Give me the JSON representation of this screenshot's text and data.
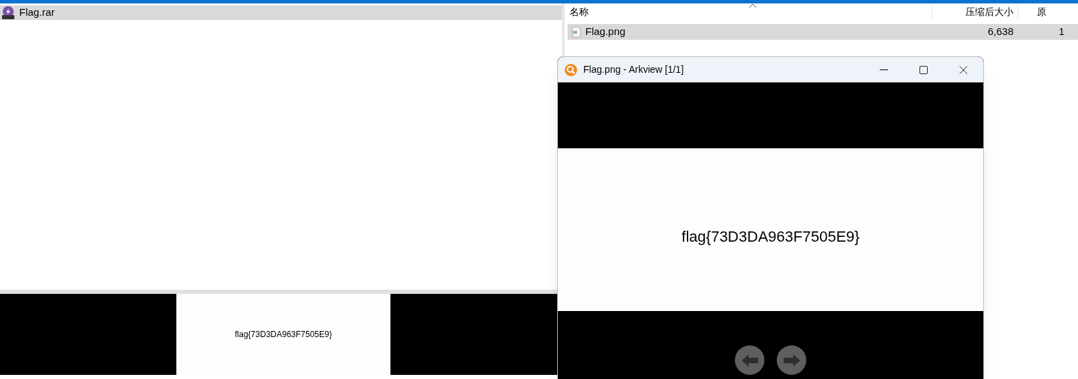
{
  "tree": {
    "items": [
      {
        "label": "Flag.rar",
        "selected": true
      }
    ]
  },
  "preview": {
    "image_text": "flag{73D3DA963F7505E9}"
  },
  "file_list": {
    "columns": [
      "名称",
      "压缩后大小",
      "原"
    ],
    "rows": [
      {
        "cells": [
          "Flag.png",
          "6,638",
          "1"
        ],
        "selected": true
      }
    ]
  },
  "viewer": {
    "title": "Flag.png - Arkview [1/1]",
    "image_text": "flag{73D3DA963F7505E9}"
  }
}
